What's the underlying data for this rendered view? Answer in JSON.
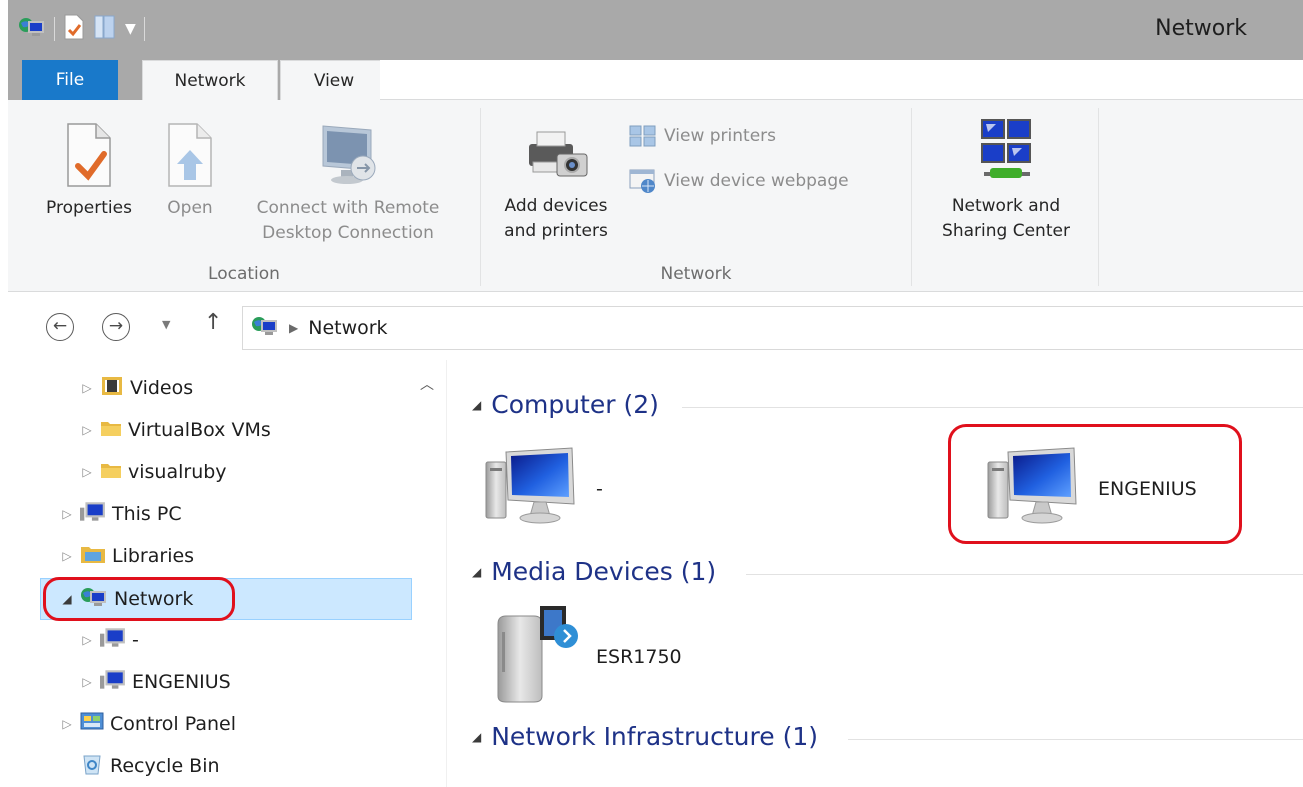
{
  "window": {
    "title": "Network"
  },
  "ribbon_tabs": {
    "file": "File",
    "network": "Network",
    "view": "View"
  },
  "ribbon": {
    "location": {
      "label": "Location",
      "properties": "Properties",
      "open": "Open",
      "remote_line1": "Connect with Remote",
      "remote_line2": "Desktop Connection"
    },
    "network": {
      "label": "Network",
      "add_devices_line1": "Add devices",
      "add_devices_line2": "and printers",
      "view_printers": "View printers",
      "view_device_webpage": "View device webpage"
    },
    "sharing": {
      "line1": "Network and",
      "line2": "Sharing Center"
    }
  },
  "address_bar": {
    "path": "Network"
  },
  "nav_tree": [
    {
      "label": "Videos"
    },
    {
      "label": "VirtualBox VMs"
    },
    {
      "label": "visualruby"
    },
    {
      "label": "This PC"
    },
    {
      "label": "Libraries"
    },
    {
      "label": "Network"
    },
    {
      "label": "-"
    },
    {
      "label": "ENGENIUS"
    },
    {
      "label": "Control Panel"
    },
    {
      "label": "Recycle Bin"
    }
  ],
  "content": {
    "groups": [
      {
        "title": "Computer (2)",
        "items": [
          "-",
          "ENGENIUS"
        ]
      },
      {
        "title": "Media Devices (1)",
        "items": [
          "ESR1750"
        ]
      },
      {
        "title": "Network Infrastructure (1)",
        "items": []
      }
    ]
  },
  "colors": {
    "accent": "#1979ca",
    "highlight": "#e0101c",
    "selection": "#cce8ff",
    "group_heading": "#1e3287"
  }
}
